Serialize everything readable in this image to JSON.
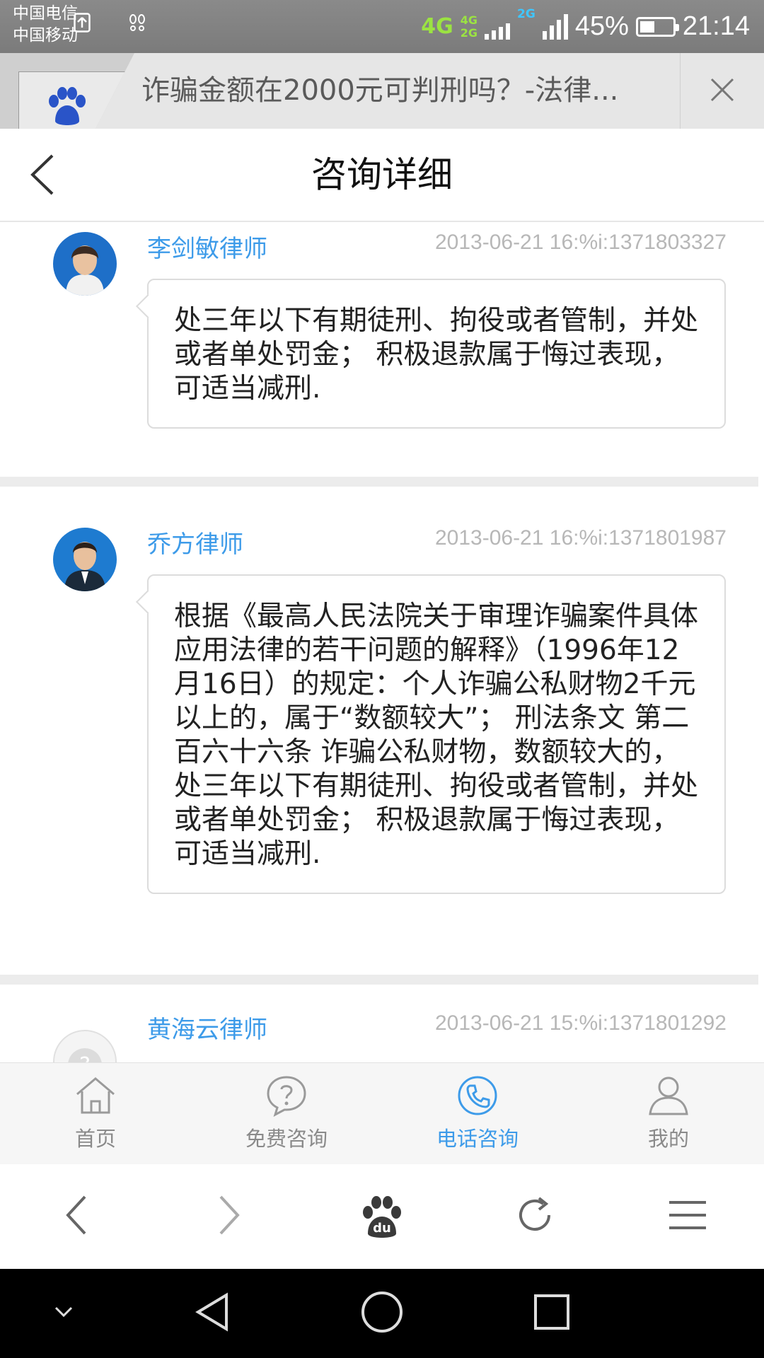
{
  "status_bar": {
    "carrier_1": "中国电信",
    "carrier_2": "中国移动",
    "network_1": "4G",
    "network_2a": "4G",
    "network_2b": "2G",
    "network_3": "2G",
    "battery_percent": "45%",
    "battery_level": 0.45,
    "time": "21:14"
  },
  "browser_tab": {
    "title": "诈骗金额在2000元可判刑吗？-法律...",
    "icons": {
      "favicon": "baidu-paw-icon",
      "close": "close-icon"
    }
  },
  "header": {
    "title": "咨询详细",
    "back_icon": "chevron-left-icon"
  },
  "answers": [
    {
      "lawyer": "李剑敏律师",
      "time": "2013-06-21 16:%i:1371803327",
      "text": "处三年以下有期徒刑、拘役或者管制，并处或者单处罚金； 积极退款属于悔过表现，可适当减刑."
    },
    {
      "lawyer": "乔方律师",
      "time": "2013-06-21 16:%i:1371801987",
      "text": "根据《最高人民法院关于审理诈骗案件具体应用法律的若干问题的解释》（1996年12月16日）的规定：个人诈骗公私财物2千元以上的，属于“数额较大”； 刑法条文 第二百六十六条 诈骗公私财物，数额较大的，处三年以下有期徒刑、拘役或者管制，并处或者单处罚金； 积极退款属于悔过表现，可适当减刑."
    },
    {
      "lawyer": "黄海云律师",
      "time": "2013-06-21 15:%i:1371801292",
      "text": ""
    }
  ],
  "app_nav": {
    "items": [
      {
        "label": "首页",
        "icon": "home-icon",
        "active": false
      },
      {
        "label": "免费咨询",
        "icon": "question-bubble-icon",
        "active": false
      },
      {
        "label": "电话咨询",
        "icon": "phone-icon",
        "active": true
      },
      {
        "label": "我的",
        "icon": "user-icon",
        "active": false
      }
    ],
    "active_color": "#3d9be9",
    "inactive_color": "#8a8a8a"
  },
  "browser_toolbar": {
    "icons": [
      "back-arrow-icon",
      "forward-arrow-icon",
      "baidu-du-icon",
      "refresh-icon",
      "menu-icon"
    ],
    "du_label": "du"
  },
  "system_nav": {
    "icons": [
      "collapse-chevron-icon",
      "back-triangle-icon",
      "home-circle-icon",
      "recents-square-icon"
    ]
  }
}
